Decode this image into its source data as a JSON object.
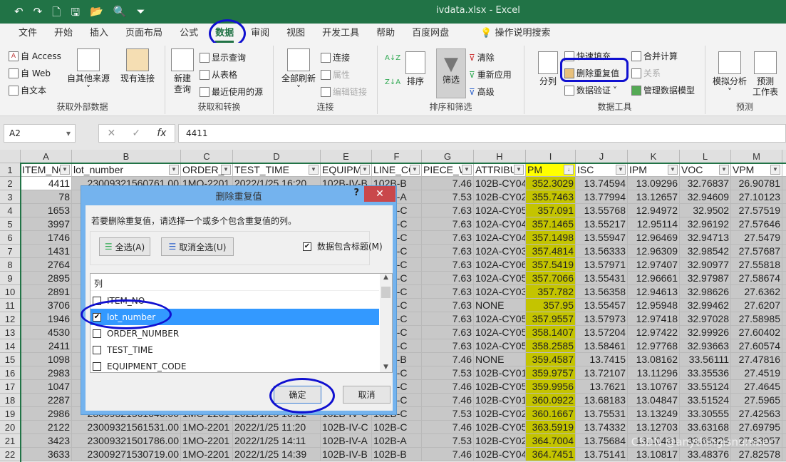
{
  "titlebar": {
    "file_title": "ivdata.xlsx  -  Excel",
    "qat": [
      "↶",
      "↷",
      "🗋",
      "🖫",
      "📂",
      "🔍",
      "⏷"
    ]
  },
  "tabs": [
    "文件",
    "开始",
    "插入",
    "页面布局",
    "公式",
    "数据",
    "审阅",
    "视图",
    "开发工具",
    "帮助",
    "百度网盘",
    "操作说明搜索"
  ],
  "active_tab": "数据",
  "ribbon": {
    "get_external": {
      "label": "获取外部数据",
      "from_access": "自 Access",
      "from_web": "自 Web",
      "from_text": "自文本",
      "from_other": "自其他来源",
      "existing": "现有连接"
    },
    "get_transform": {
      "label": "获取和转换",
      "new_query": "新建\n查询",
      "show_queries": "显示查询",
      "from_table": "从表格",
      "recent_sources": "最近使用的源"
    },
    "connections": {
      "label": "连接",
      "refresh_all": "全部刷新",
      "connections": "连接",
      "properties": "属性",
      "edit_links": "编辑链接"
    },
    "sort_filter": {
      "label": "排序和筛选",
      "sort": "排序",
      "filter": "筛选",
      "clear": "清除",
      "reapply": "重新应用",
      "advanced": "高级"
    },
    "data_tools": {
      "label": "数据工具",
      "text_to_columns": "分列",
      "flash_fill": "快速填充",
      "remove_duplicates": "删除重复值",
      "data_validation": "数据验证",
      "consolidate": "合并计算",
      "relationships": "关系",
      "manage_model": "管理数据模型"
    },
    "forecast": {
      "label": "预测",
      "what_if": "模拟分析",
      "forecast_sheet": "预测\n工作表"
    }
  },
  "formula_bar": {
    "name_box": "A2",
    "cancel": "✕",
    "enter": "✓",
    "fx": "fx",
    "value": "4411"
  },
  "sheet": {
    "columns": [
      "A",
      "B",
      "C",
      "D",
      "E",
      "F",
      "G",
      "H",
      "I",
      "J",
      "K",
      "L",
      "M"
    ],
    "headers": [
      "ITEM_NO",
      "lot_number",
      "ORDER_",
      "TEST_TIME",
      "EQUIPM",
      "LINE_CO",
      "PIECE_W",
      "ATTRIBU",
      "PM",
      "ISC",
      "IPM",
      "VOC",
      "VPM"
    ],
    "rows": [
      [
        "4411",
        "23009321560761.00",
        "1MO-2201",
        "2022/1/25 16:20",
        "102B-IV-B",
        "102B-B",
        "7.46",
        "102B-CY04",
        "352.3029",
        "13.74594",
        "13.09296",
        "32.76837",
        "26.90781"
      ],
      [
        "78",
        "",
        "",
        "",
        "",
        "102B-A",
        "7.53",
        "102B-CY02",
        "355.7463",
        "13.77994",
        "13.12657",
        "32.94609",
        "27.10123"
      ],
      [
        "1653",
        "",
        "",
        "",
        "",
        "102A-C",
        "7.63",
        "102A-CY05",
        "357.091",
        "13.55768",
        "12.94972",
        "32.9502",
        "27.57519"
      ],
      [
        "3997",
        "",
        "",
        "",
        "",
        "102A-C",
        "7.63",
        "102A-CY04",
        "357.1465",
        "13.55217",
        "12.95114",
        "32.96192",
        "27.57646"
      ],
      [
        "1746",
        "",
        "",
        "",
        "",
        "102A-C",
        "7.63",
        "102A-CY04",
        "357.1498",
        "13.55947",
        "12.96469",
        "32.94713",
        "27.5479"
      ],
      [
        "1431",
        "",
        "",
        "",
        "",
        "102A-C",
        "7.63",
        "102A-CY03",
        "357.4814",
        "13.56333",
        "12.96309",
        "32.98542",
        "27.57687"
      ],
      [
        "2764",
        "",
        "",
        "",
        "",
        "102A-C",
        "7.63",
        "102A-CY06",
        "357.5419",
        "13.57971",
        "12.97407",
        "32.90977",
        "27.55818"
      ],
      [
        "2895",
        "",
        "",
        "",
        "",
        "102A-C",
        "7.63",
        "102A-CY05",
        "357.7066",
        "13.55431",
        "12.96661",
        "32.97987",
        "27.58674"
      ],
      [
        "2891",
        "",
        "",
        "",
        "",
        "102A-C",
        "7.63",
        "102A-CY03",
        "357.782",
        "13.56358",
        "12.94613",
        "32.98626",
        "27.6362"
      ],
      [
        "3706",
        "",
        "",
        "",
        "",
        "102A-C",
        "7.63",
        "NONE",
        "357.95",
        "13.55457",
        "12.95948",
        "32.99462",
        "27.6207"
      ],
      [
        "1946",
        "",
        "",
        "",
        "",
        "102A-C",
        "7.63",
        "102A-CY05",
        "357.9557",
        "13.57973",
        "12.97418",
        "32.97028",
        "27.58985"
      ],
      [
        "4530",
        "",
        "",
        "",
        "",
        "102A-C",
        "7.63",
        "102A-CY05",
        "358.1407",
        "13.57204",
        "12.97422",
        "32.99926",
        "27.60402"
      ],
      [
        "2411",
        "",
        "",
        "",
        "",
        "102A-C",
        "7.63",
        "102A-CY05",
        "358.2585",
        "13.58461",
        "12.97768",
        "32.93663",
        "27.60574"
      ],
      [
        "1098",
        "",
        "",
        "",
        "",
        "102B-B",
        "7.46",
        "NONE",
        "359.4587",
        "13.7415",
        "13.08162",
        "33.56111",
        "27.47816"
      ],
      [
        "2983",
        "",
        "",
        "",
        "",
        "102B-C",
        "7.53",
        "102B-CY01",
        "359.9757",
        "13.72107",
        "13.11296",
        "33.35536",
        "27.4519"
      ],
      [
        "1047",
        "",
        "",
        "",
        "",
        "102B-C",
        "7.46",
        "102B-CY05",
        "359.9956",
        "13.7621",
        "13.10767",
        "33.55124",
        "27.4645"
      ],
      [
        "2287",
        "",
        "",
        "",
        "",
        "102B-C",
        "7.46",
        "102B-CY01",
        "360.0922",
        "13.68183",
        "13.04847",
        "33.51524",
        "27.5965"
      ],
      [
        "2986",
        "23009321561646.00",
        "1MO-2201",
        "2022/1/25 10:22",
        "102B-IV-C",
        "102B-C",
        "7.53",
        "102B-CY02",
        "360.1667",
        "13.75531",
        "13.13249",
        "33.30555",
        "27.42563"
      ],
      [
        "2122",
        "23009321561531.00",
        "1MO-2201",
        "2022/1/25 11:20",
        "102B-IV-C",
        "102B-C",
        "7.46",
        "102B-CY05",
        "363.5919",
        "13.74332",
        "13.12703",
        "33.63168",
        "27.69795"
      ],
      [
        "3423",
        "23009321501786.00",
        "1MO-2201",
        "2022/1/25 14:11",
        "102B-IV-A",
        "102B-A",
        "7.53",
        "102B-CY02",
        "364.7004",
        "13.75684",
        "13.10431",
        "33.65325",
        "27.83057"
      ],
      [
        "3633",
        "23009271530719.00",
        "1MO-2201",
        "2022/1/25 14:39",
        "102B-IV-B",
        "102B-B",
        "7.46",
        "102B-CY04",
        "364.7451",
        "13.75141",
        "13.10817",
        "33.48376",
        "27.82578"
      ]
    ],
    "numeric_cols": [
      0,
      1,
      6,
      8,
      9,
      10,
      11,
      12
    ],
    "sorted_col": "PM"
  },
  "dialog": {
    "title": "删除重复值",
    "help": "?",
    "close": "✕",
    "instruction": "若要删除重复值，请选择一个或多个包含重复值的列。",
    "select_all": "全选(A)",
    "unselect_all": "取消全选(U)",
    "has_headers_label": "数据包含标题(M)",
    "has_headers": true,
    "list_header": "列",
    "columns": [
      {
        "name": "ITEM_NO",
        "checked": false
      },
      {
        "name": "lot_number",
        "checked": true,
        "selected": true
      },
      {
        "name": "ORDER_NUMBER",
        "checked": false
      },
      {
        "name": "TEST_TIME",
        "checked": false
      },
      {
        "name": "EQUIPMENT_CODE",
        "checked": false
      }
    ],
    "ok": "确定",
    "cancel": "取消"
  },
  "watermark": "CSDN @anythingisnumber",
  "colors": {
    "excel_green": "#217346",
    "pm_highlight": "#c4c400",
    "annotation": "#1010d0"
  }
}
